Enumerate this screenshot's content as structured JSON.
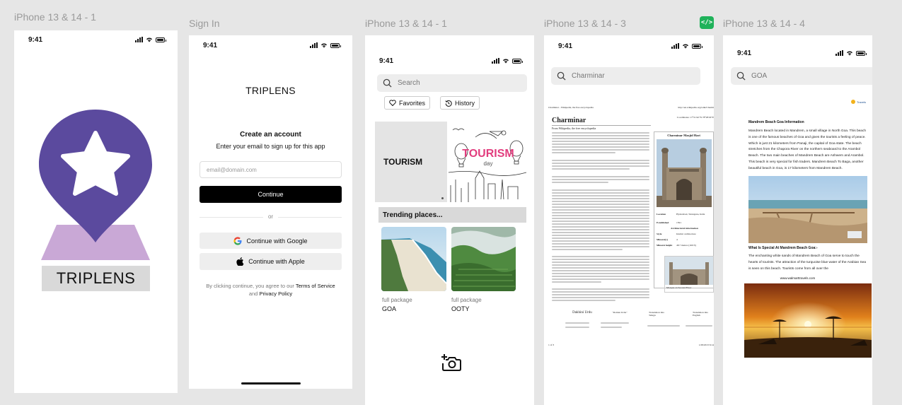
{
  "frames": {
    "f1": {
      "label": "iPhone 13 & 14 - 1",
      "time": "9:41",
      "logo_text": "TRIPLENS"
    },
    "f2": {
      "label": "Sign In",
      "time": "9:41",
      "title": "TRIPLENS",
      "heading": "Create an account",
      "subheading": "Enter your email to sign up for this app",
      "email_placeholder": "email@domain.com",
      "continue_label": "Continue",
      "or_label": "or",
      "google_label": "Continue with Google",
      "apple_label": "Continue with Apple",
      "terms_prefix": "By clicking continue, you agree to our",
      "terms_link": "Terms of Service",
      "terms_and": "and",
      "privacy_link": "Privacy Policy"
    },
    "f3": {
      "label": "iPhone 13 & 14 - 1",
      "time": "9:41",
      "search_placeholder": "Search",
      "favorites_label": "Favorites",
      "history_label": "History",
      "banner_title": "TOURISM",
      "banner_art_title": "TOURISM",
      "banner_art_sub": "day",
      "trending_label": "Trending places...",
      "places": [
        {
          "tag": "full package",
          "name": "GOA"
        },
        {
          "tag": "full package",
          "name": "OOTY"
        }
      ]
    },
    "f4": {
      "label": "iPhone 13 & 14 - 3",
      "time": "9:41",
      "search_value": "Charminar",
      "doc_header_left": "Charminar - Wikipedia, the free encyclopedia",
      "doc_header_right": "http://en.wikipedia.org/wiki/Charmi",
      "doc_coords": "Coordinates: 17°21'42\"N 78°28'29\"E",
      "doc_title": "Charminar",
      "doc_subtitle": "From Wikipedia, the free encyclopedia",
      "infobox_title": "Charminar Masjid Hari",
      "infobox_rows": [
        {
          "k": "Location",
          "v": "Hyderabad, Telangana, India"
        },
        {
          "k": "Established",
          "v": "1591"
        },
        {
          "k": "Style",
          "v": "Islamic architecture"
        },
        {
          "k": "Minaret(s)",
          "v": "4"
        },
        {
          "k": "Minaret height",
          "v": "48.7 metres (160 ft)"
        }
      ],
      "infobox_section": "Architectural information",
      "caption": "Mosque on Second Floor",
      "table_heads": [
        "Dakhini Urdu",
        "\"Roman Urdu\"",
        "Translation into Telugu",
        "Translation into English"
      ],
      "footer_left": "1 of 3",
      "footer_right": "1/28/2013 6:14"
    },
    "f5": {
      "label": "iPhone 13 & 14 - 4",
      "time": "9:41",
      "search_value": "GOA",
      "heading": "Mandrem Beach Goa Information",
      "para1": "Mandrem Beach located in Mandrem, a small village in North Goa. This beach is one of the famous beaches of Goa and gives the tourists a feeling of peace. Which is just 21 kilometers from Panaji, the capital of Goa state. The beach stretches from the Chapora River on the northern seaboard to the Arambol Beach. The two main beaches of Mandrem Beach are Ashwem and Arambol. This beach is very special for fish traders. Mandrem Beach To Baga, another beautiful beach in Goa, is 17 kilometers from Mandrem Beach.",
      "heading2": "What Is Special At Mandrem Beach Goa:-",
      "para2": "The enchanting white sands of Mandrem Beach of Goa serve to touch the hearts of tourists. The attraction of the turquoise blue water of the Arabian Sea is seen on this beach. Tourists come from all over the",
      "url": "www.walmarttravels.com",
      "logo_text": "Travels"
    }
  },
  "colors": {
    "pin": "#5b4a9e",
    "pin_base": "#c9a8d6",
    "label_bg": "#d9d9d9",
    "black": "#000000",
    "code_badge": "#1fb25a"
  }
}
